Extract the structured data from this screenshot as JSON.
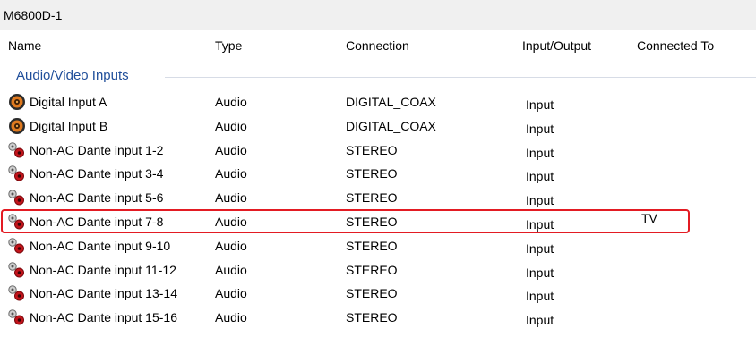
{
  "window": {
    "title": "M6800D-1"
  },
  "columns": [
    "Name",
    "Type",
    "Connection",
    "Input/Output",
    "Connected To"
  ],
  "group": {
    "label": "Audio/Video Inputs"
  },
  "rows": [
    {
      "icon": "digital-coax-icon",
      "name": "Digital Input A",
      "type": "Audio",
      "connection": "DIGITAL_COAX",
      "io": "Input",
      "connected_to": ""
    },
    {
      "icon": "digital-coax-icon",
      "name": "Digital Input B",
      "type": "Audio",
      "connection": "DIGITAL_COAX",
      "io": "Input",
      "connected_to": ""
    },
    {
      "icon": "stereo-rca-icon",
      "name": "Non-AC Dante input 1-2",
      "type": "Audio",
      "connection": "STEREO",
      "io": "Input",
      "connected_to": ""
    },
    {
      "icon": "stereo-rca-icon",
      "name": "Non-AC Dante input 3-4",
      "type": "Audio",
      "connection": "STEREO",
      "io": "Input",
      "connected_to": ""
    },
    {
      "icon": "stereo-rca-icon",
      "name": "Non-AC Dante input 5-6",
      "type": "Audio",
      "connection": "STEREO",
      "io": "Input",
      "connected_to": ""
    },
    {
      "icon": "stereo-rca-icon",
      "name": "Non-AC Dante input 7-8",
      "type": "Audio",
      "connection": "STEREO",
      "io": "Input",
      "connected_to": "TV"
    },
    {
      "icon": "stereo-rca-icon",
      "name": "Non-AC Dante input 9-10",
      "type": "Audio",
      "connection": "STEREO",
      "io": "Input",
      "connected_to": ""
    },
    {
      "icon": "stereo-rca-icon",
      "name": "Non-AC Dante input 11-12",
      "type": "Audio",
      "connection": "STEREO",
      "io": "Input",
      "connected_to": ""
    },
    {
      "icon": "stereo-rca-icon",
      "name": "Non-AC Dante input 13-14",
      "type": "Audio",
      "connection": "STEREO",
      "io": "Input",
      "connected_to": ""
    },
    {
      "icon": "stereo-rca-icon",
      "name": "Non-AC Dante input 15-16",
      "type": "Audio",
      "connection": "STEREO",
      "io": "Input",
      "connected_to": ""
    }
  ],
  "colors": {
    "group_label": "#1f4e9a",
    "highlight": "#e31b23",
    "coax_orange": "#e07a1f"
  }
}
